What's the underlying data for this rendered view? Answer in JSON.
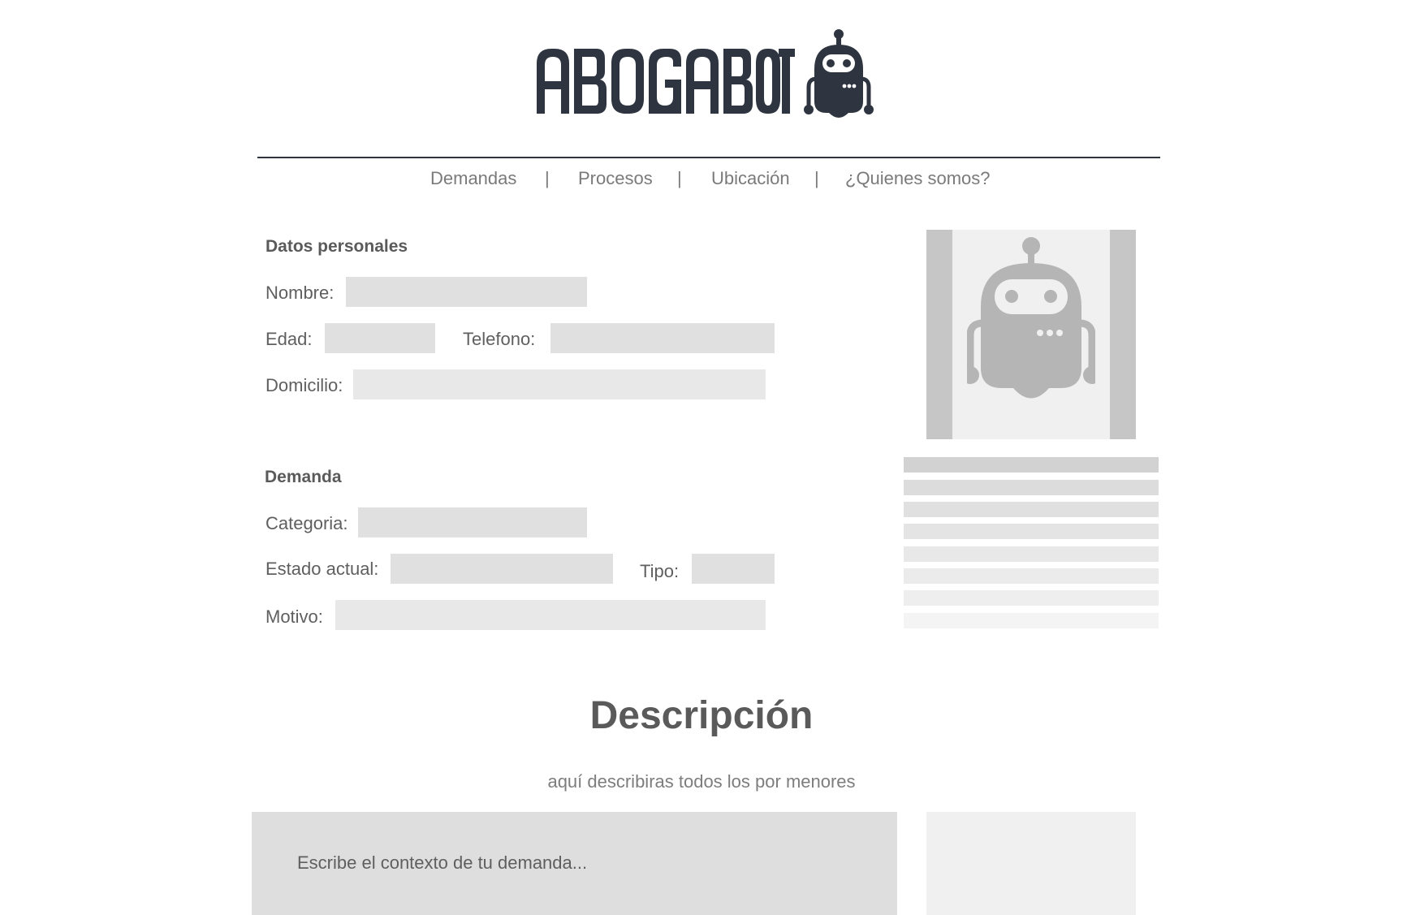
{
  "header": {
    "logo_text": "ABOGABOT",
    "logo_icon": "robot-icon",
    "accent_color": "#2e3540"
  },
  "nav": {
    "items": [
      {
        "label": "Demandas"
      },
      {
        "label": "Procesos"
      },
      {
        "label": "Ubicación"
      },
      {
        "label": "¿Quienes somos?"
      }
    ],
    "separator": "|"
  },
  "personal": {
    "title": "Datos personales",
    "nombre_label": "Nombre:",
    "edad_label": "Edad:",
    "telefono_label": "Telefono:",
    "domicilio_label": "Domicilio:"
  },
  "demanda": {
    "title": "Demanda",
    "categoria_label": "Categoria:",
    "estado_label": "Estado actual:",
    "tipo_label": "Tipo:",
    "motivo_label": "Motivo:"
  },
  "sidebar": {
    "photo_icon": "robot-icon"
  },
  "description": {
    "title": "Descripción",
    "subtitle": "aquí describiras todos los por menores",
    "placeholder": "Escribe el contexto de tu demanda..."
  }
}
